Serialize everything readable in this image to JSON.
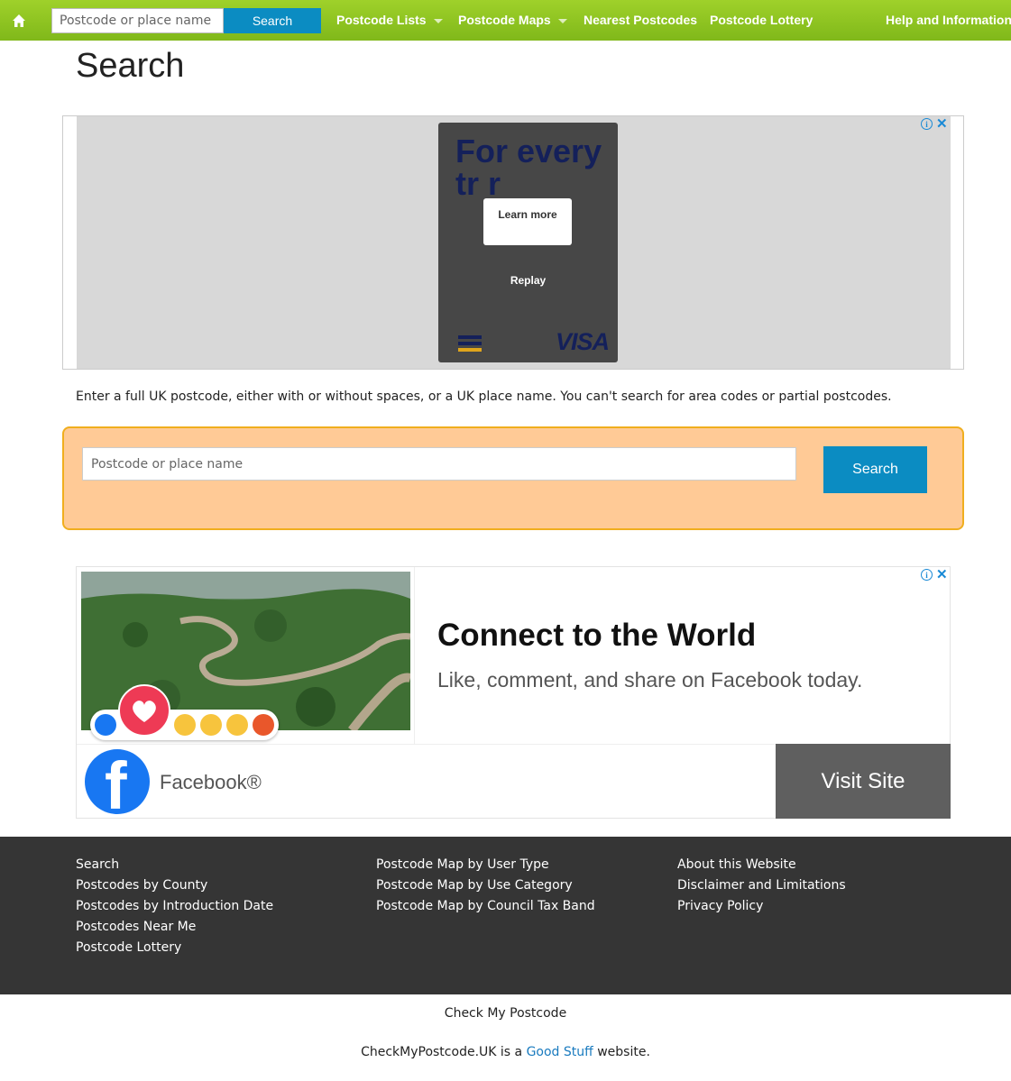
{
  "topnav": {
    "search_placeholder": "Postcode or place name",
    "search_button": "Search",
    "items": [
      {
        "label": "Postcode Lists"
      },
      {
        "label": "Postcode Maps"
      },
      {
        "label": "Nearest Postcodes"
      },
      {
        "label": "Postcode Lottery"
      },
      {
        "label": "Help and Information"
      }
    ]
  },
  "page_title": "Search",
  "ad_top": {
    "headline": "For every tr  r",
    "learn_more": "Learn more",
    "replay": "Replay",
    "brand": "VISA"
  },
  "intro_text": "Enter a full UK postcode, either with or without spaces, or a UK place name. You can't search for area codes or partial postcodes.",
  "search_form": {
    "placeholder": "Postcode or place name",
    "button": "Search"
  },
  "ad_bottom": {
    "title": "Connect to the World",
    "subtitle": "Like, comment, and share on Facebook today.",
    "advertiser": "Facebook®",
    "cta": "Visit Site"
  },
  "footer": {
    "col1": [
      "Search",
      "Postcodes by County",
      "Postcodes by Introduction Date",
      "Postcodes Near Me",
      "Postcode Lottery"
    ],
    "col2": [
      "Postcode Map by User Type",
      "Postcode Map by Use Category",
      "Postcode Map by Council Tax Band"
    ],
    "col3": [
      "About this Website",
      "Disclaimer and Limitations",
      "Privacy Policy"
    ]
  },
  "site_name": "Check My Postcode",
  "credit": {
    "prefix": "CheckMyPostcode.UK is a ",
    "link": "Good Stuff",
    "suffix": " website."
  },
  "colors": {
    "nav_green": "#8cc41f",
    "button_blue": "#0b8cc2",
    "search_panel": "#ffca96",
    "footer_bg": "#353535"
  }
}
